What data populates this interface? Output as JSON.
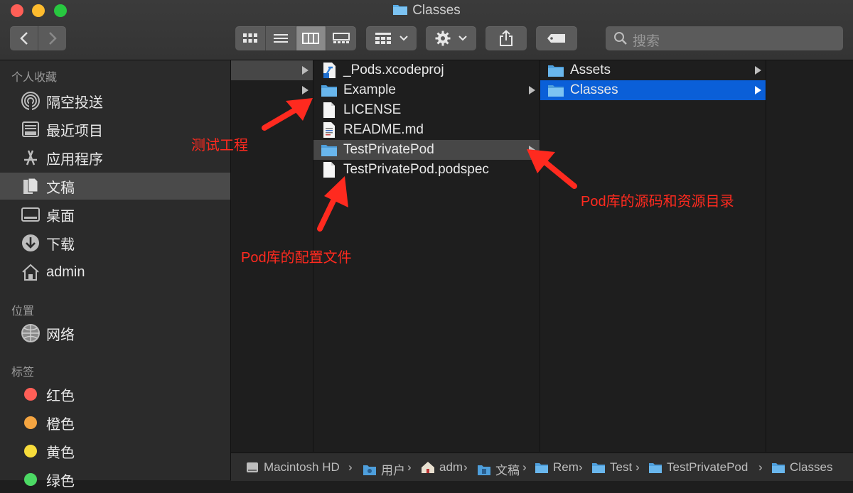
{
  "window": {
    "title": "Classes"
  },
  "toolbar": {
    "search_placeholder": "搜索",
    "icons": [
      "back-icon",
      "forward-icon",
      "icon-view-icon",
      "list-view-icon",
      "column-view-icon",
      "gallery-view-icon",
      "group-icon",
      "gear-icon",
      "share-icon",
      "tag-icon",
      "search-icon"
    ]
  },
  "sidebar": {
    "favorites_header": "个人收藏",
    "favorites": [
      {
        "label": "隔空投送",
        "icon": "airdrop-icon"
      },
      {
        "label": "最近项目",
        "icon": "recents-icon"
      },
      {
        "label": "应用程序",
        "icon": "applications-icon"
      },
      {
        "label": "文稿",
        "icon": "documents-icon",
        "selected": true
      },
      {
        "label": "桌面",
        "icon": "desktop-icon"
      },
      {
        "label": "下载",
        "icon": "downloads-icon"
      },
      {
        "label": "admin",
        "icon": "home-icon"
      }
    ],
    "locations_header": "位置",
    "locations": [
      {
        "label": "网络",
        "icon": "network-icon"
      }
    ],
    "tags_header": "标签",
    "tags": [
      {
        "label": "红色",
        "color": "#ff5f57"
      },
      {
        "label": "橙色",
        "color": "#f5a541"
      },
      {
        "label": "黄色",
        "color": "#f7dc3b"
      },
      {
        "label": "绿色",
        "color": "#4cd964"
      }
    ]
  },
  "columns": {
    "col2": [
      {
        "label": "_Pods.xcodeproj",
        "icon": "xcodeproj-icon"
      },
      {
        "label": "Example",
        "icon": "folder-icon",
        "has_children": true
      },
      {
        "label": "LICENSE",
        "icon": "file-icon"
      },
      {
        "label": "README.md",
        "icon": "text-file-icon"
      },
      {
        "label": "TestPrivatePod",
        "icon": "folder-icon",
        "has_children": true,
        "selected": true
      },
      {
        "label": "TestPrivatePod.podspec",
        "icon": "file-icon"
      }
    ],
    "col3": [
      {
        "label": "Assets",
        "icon": "folder-icon",
        "has_children": true
      },
      {
        "label": "Classes",
        "icon": "folder-icon",
        "has_children": true,
        "selected": true
      }
    ]
  },
  "pathbar": {
    "crumbs": [
      {
        "label": "Macintosh HD",
        "icon": "disk-icon"
      },
      {
        "label": "用户",
        "icon": "users-folder-icon"
      },
      {
        "label": "adm",
        "icon": "home-icon"
      },
      {
        "label": "文稿",
        "icon": "documents-folder-icon"
      },
      {
        "label": "Rem",
        "icon": "folder-icon"
      },
      {
        "label": "Test",
        "icon": "folder-icon"
      },
      {
        "label": "TestPrivatePod",
        "icon": "folder-icon"
      },
      {
        "label": "Classes",
        "icon": "folder-icon"
      }
    ],
    "separator": "›"
  },
  "annotations": {
    "test_project": "测试工程",
    "pod_source": "Pod库的源码和资源目录",
    "pod_config": "Pod库的配置文件",
    "color": "#ff2a1f"
  }
}
